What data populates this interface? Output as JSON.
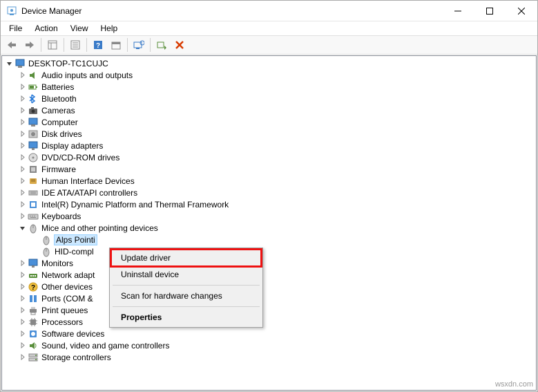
{
  "window": {
    "title": "Device Manager"
  },
  "menu": {
    "file": "File",
    "action": "Action",
    "view": "View",
    "help": "Help"
  },
  "tree": {
    "root": "DESKTOP-TC1CUJC",
    "nodes": [
      {
        "label": "Audio inputs and outputs",
        "icon": "audio",
        "expanded": false
      },
      {
        "label": "Batteries",
        "icon": "battery",
        "expanded": false
      },
      {
        "label": "Bluetooth",
        "icon": "bluetooth",
        "expanded": false
      },
      {
        "label": "Cameras",
        "icon": "camera",
        "expanded": false
      },
      {
        "label": "Computer",
        "icon": "computer",
        "expanded": false
      },
      {
        "label": "Disk drives",
        "icon": "disk",
        "expanded": false
      },
      {
        "label": "Display adapters",
        "icon": "display",
        "expanded": false
      },
      {
        "label": "DVD/CD-ROM drives",
        "icon": "dvd",
        "expanded": false
      },
      {
        "label": "Firmware",
        "icon": "firmware",
        "expanded": false
      },
      {
        "label": "Human Interface Devices",
        "icon": "hid",
        "expanded": false
      },
      {
        "label": "IDE ATA/ATAPI controllers",
        "icon": "ide",
        "expanded": false
      },
      {
        "label": "Intel(R) Dynamic Platform and Thermal Framework",
        "icon": "intel",
        "expanded": false
      },
      {
        "label": "Keyboards",
        "icon": "keyboard",
        "expanded": false
      },
      {
        "label": "Mice and other pointing devices",
        "icon": "mouse",
        "expanded": true,
        "children": [
          {
            "label": "Alps Pointi",
            "icon": "mouse",
            "selected": true
          },
          {
            "label": "HID-compl",
            "icon": "mouse"
          }
        ]
      },
      {
        "label": "Monitors",
        "icon": "monitor",
        "expanded": false
      },
      {
        "label": "Network adapt",
        "icon": "network",
        "expanded": false
      },
      {
        "label": "Other devices",
        "icon": "other",
        "expanded": false
      },
      {
        "label": "Ports (COM &",
        "icon": "ports",
        "expanded": false
      },
      {
        "label": "Print queues",
        "icon": "printer",
        "expanded": false
      },
      {
        "label": "Processors",
        "icon": "cpu",
        "expanded": false
      },
      {
        "label": "Software devices",
        "icon": "software",
        "expanded": false
      },
      {
        "label": "Sound, video and game controllers",
        "icon": "sound",
        "expanded": false
      },
      {
        "label": "Storage controllers",
        "icon": "storage",
        "expanded": false
      }
    ]
  },
  "context_menu": {
    "items": [
      {
        "label": "Update driver",
        "highlight": true
      },
      {
        "label": "Uninstall device"
      },
      {
        "sep": true
      },
      {
        "label": "Scan for hardware changes"
      },
      {
        "sep": true
      },
      {
        "label": "Properties",
        "bold": true
      }
    ]
  },
  "watermark": "wsxdn.com"
}
